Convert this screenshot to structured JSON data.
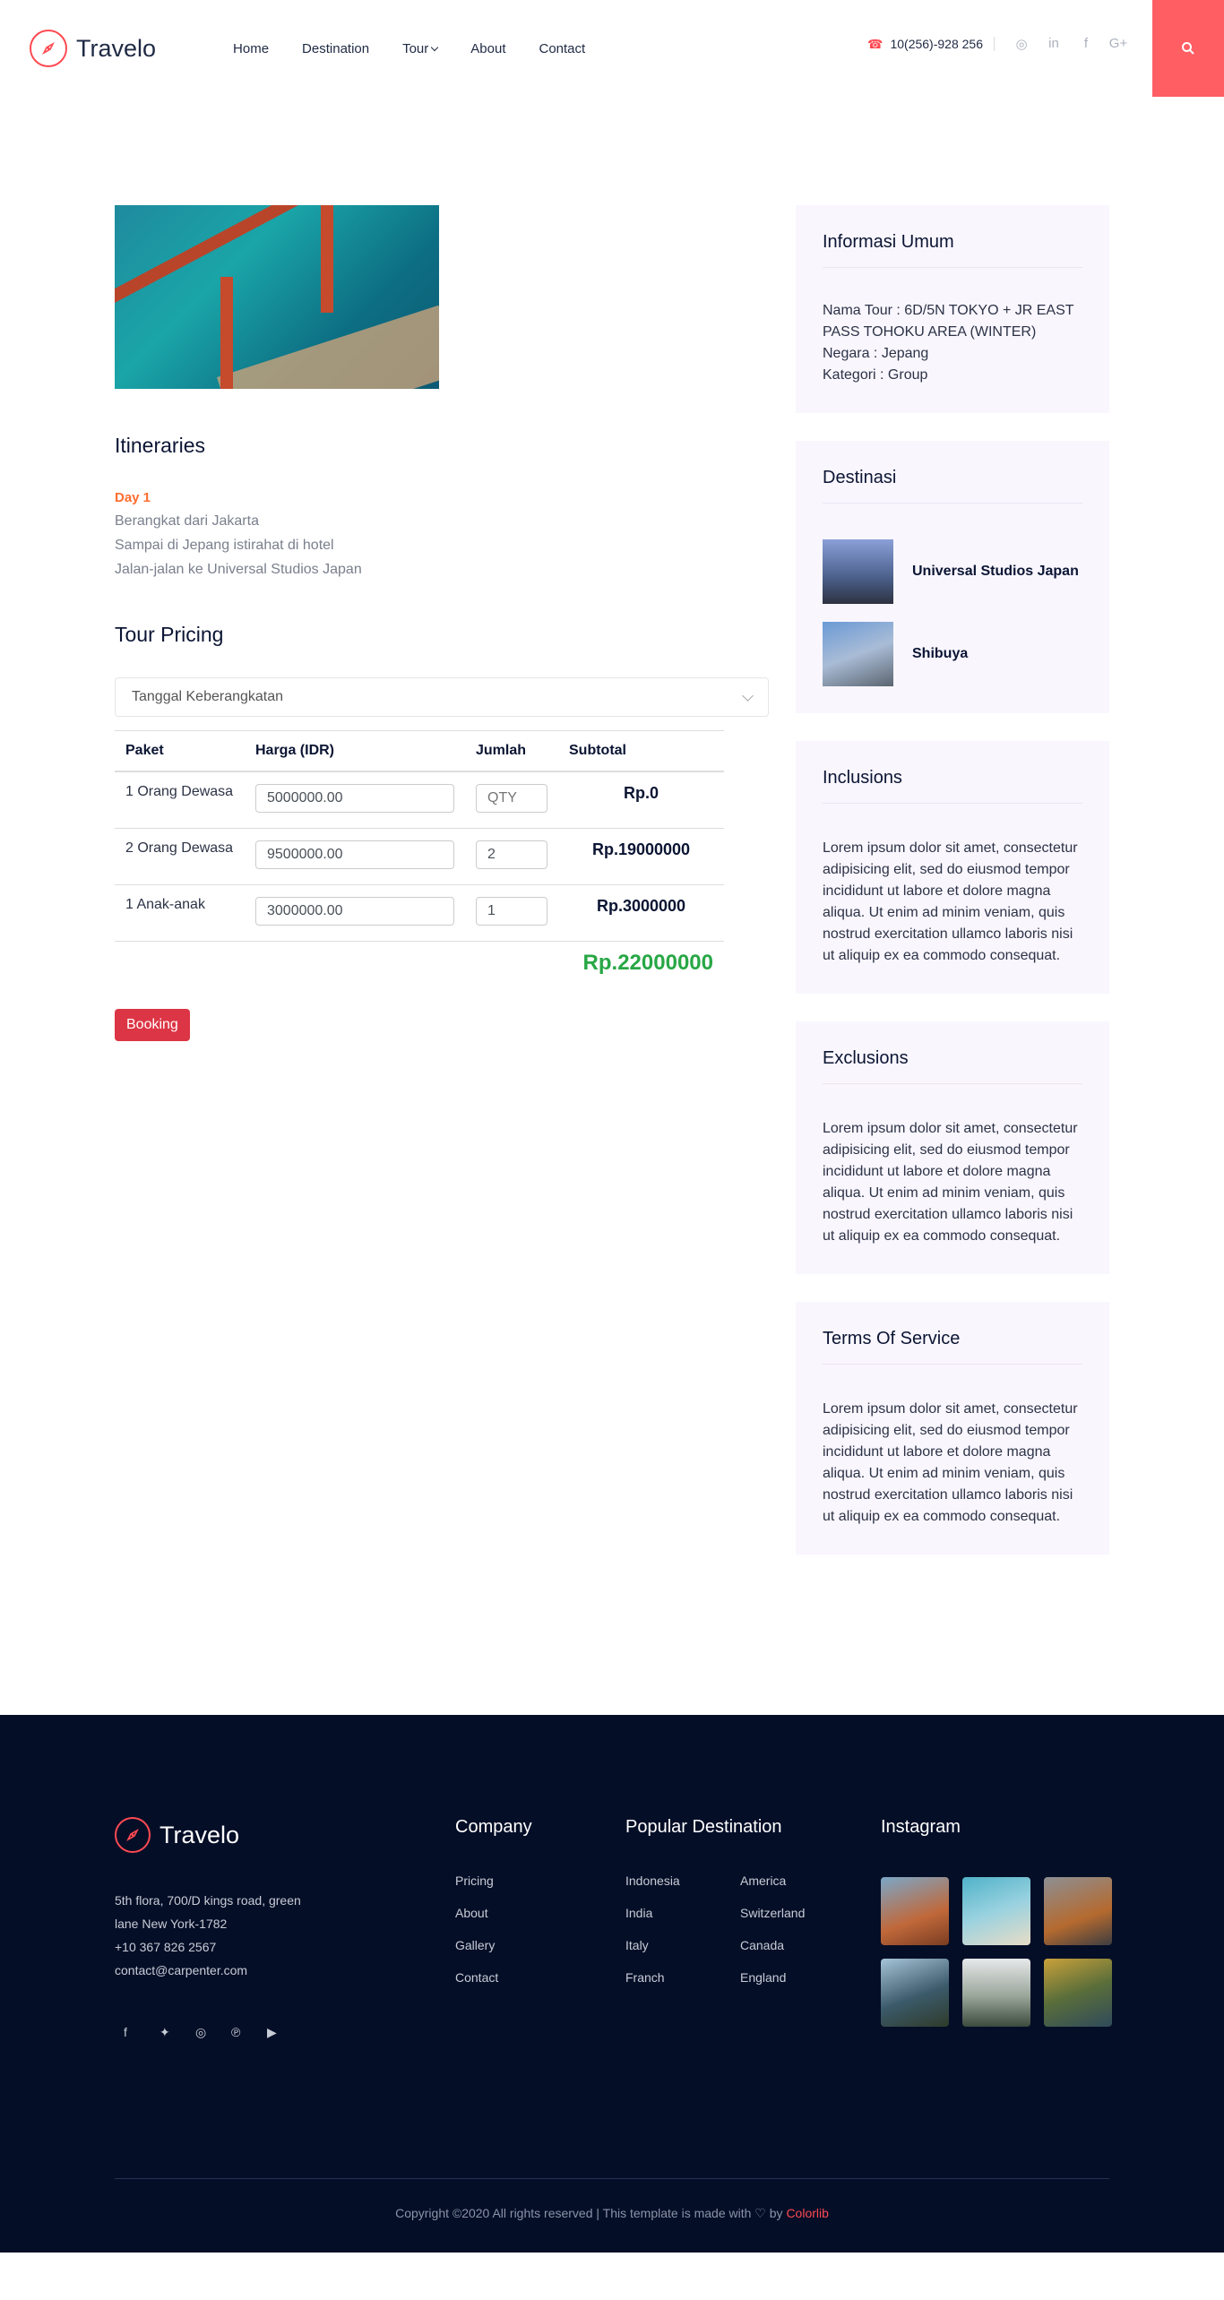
{
  "header": {
    "logo": "Travelo",
    "nav": [
      "Home",
      "Destination",
      "Tour",
      "About",
      "Contact"
    ],
    "phone": "10(256)-928 256",
    "social_icons": [
      "instagram-icon",
      "linkedin-icon",
      "facebook-icon",
      "google-plus-icon"
    ],
    "accent": "#ff5e63"
  },
  "itineraries": {
    "title": "Itineraries",
    "day": "Day 1",
    "lines": [
      "Berangkat dari Jakarta",
      "Sampai di Jepang istirahat di hotel",
      "Jalan-jalan ke Universal Studios Japan"
    ]
  },
  "pricing": {
    "title": "Tour Pricing",
    "select_label": "Tanggal Keberangkatan",
    "headers": [
      "Paket",
      "Harga (IDR)",
      "Jumlah",
      "Subtotal"
    ],
    "rows": [
      {
        "paket": "1 Orang Dewasa",
        "harga": "5000000.00",
        "jumlah": "",
        "jumlah_placeholder": "QTY",
        "subtotal": "Rp.0"
      },
      {
        "paket": "2 Orang Dewasa",
        "harga": "9500000.00",
        "jumlah": "2",
        "jumlah_placeholder": "",
        "subtotal": "Rp.19000000"
      },
      {
        "paket": "1 Anak-anak",
        "harga": "3000000.00",
        "jumlah": "1",
        "jumlah_placeholder": "",
        "subtotal": "Rp.3000000"
      }
    ],
    "total": "Rp.22000000",
    "booking_label": "Booking"
  },
  "sidebar": {
    "info": {
      "title": "Informasi Umum",
      "lines": [
        "Nama Tour : 6D/5N TOKYO + JR EAST PASS TOHOKU AREA (WINTER)",
        "Negara : Jepang",
        "Kategori : Group"
      ]
    },
    "destinasi": {
      "title": "Destinasi",
      "items": [
        "Universal Studios Japan",
        "Shibuya"
      ]
    },
    "inclusions": {
      "title": "Inclusions",
      "text": "Lorem ipsum dolor sit amet, consectetur adipisicing elit, sed do eiusmod tempor incididunt ut labore et dolore magna aliqua. Ut enim ad minim veniam, quis nostrud exercitation ullamco laboris nisi ut aliquip ex ea commodo consequat."
    },
    "exclusions": {
      "title": "Exclusions",
      "text": "Lorem ipsum dolor sit amet, consectetur adipisicing elit, sed do eiusmod tempor incididunt ut labore et dolore magna aliqua. Ut enim ad minim veniam, quis nostrud exercitation ullamco laboris nisi ut aliquip ex ea commodo consequat."
    },
    "tos": {
      "title": "Terms Of Service",
      "text": "Lorem ipsum dolor sit amet, consectetur adipisicing elit, sed do eiusmod tempor incididunt ut labore et dolore magna aliqua. Ut enim ad minim veniam, quis nostrud exercitation ullamco laboris nisi ut aliquip ex ea commodo consequat."
    }
  },
  "footer": {
    "logo": "Travelo",
    "address": [
      "5th flora, 700/D kings road, green",
      "lane New York-1782",
      "+10 367 826 2567",
      "contact@carpenter.com"
    ],
    "social_icons": [
      "facebook-icon",
      "twitter-icon",
      "instagram-icon",
      "pinterest-icon",
      "youtube-icon"
    ],
    "company": {
      "title": "Company",
      "links": [
        "Pricing",
        "About",
        "Gallery",
        "Contact"
      ]
    },
    "popular": {
      "title": "Popular Destination",
      "links": [
        "Indonesia",
        "America",
        "India",
        "Switzerland",
        "Italy",
        "Canada",
        "Franch",
        "England"
      ]
    },
    "instagram": {
      "title": "Instagram"
    },
    "copyright": "Copyright ©2020 All rights reserved | This template is made with",
    "by": "by",
    "brand": "Colorlib"
  }
}
